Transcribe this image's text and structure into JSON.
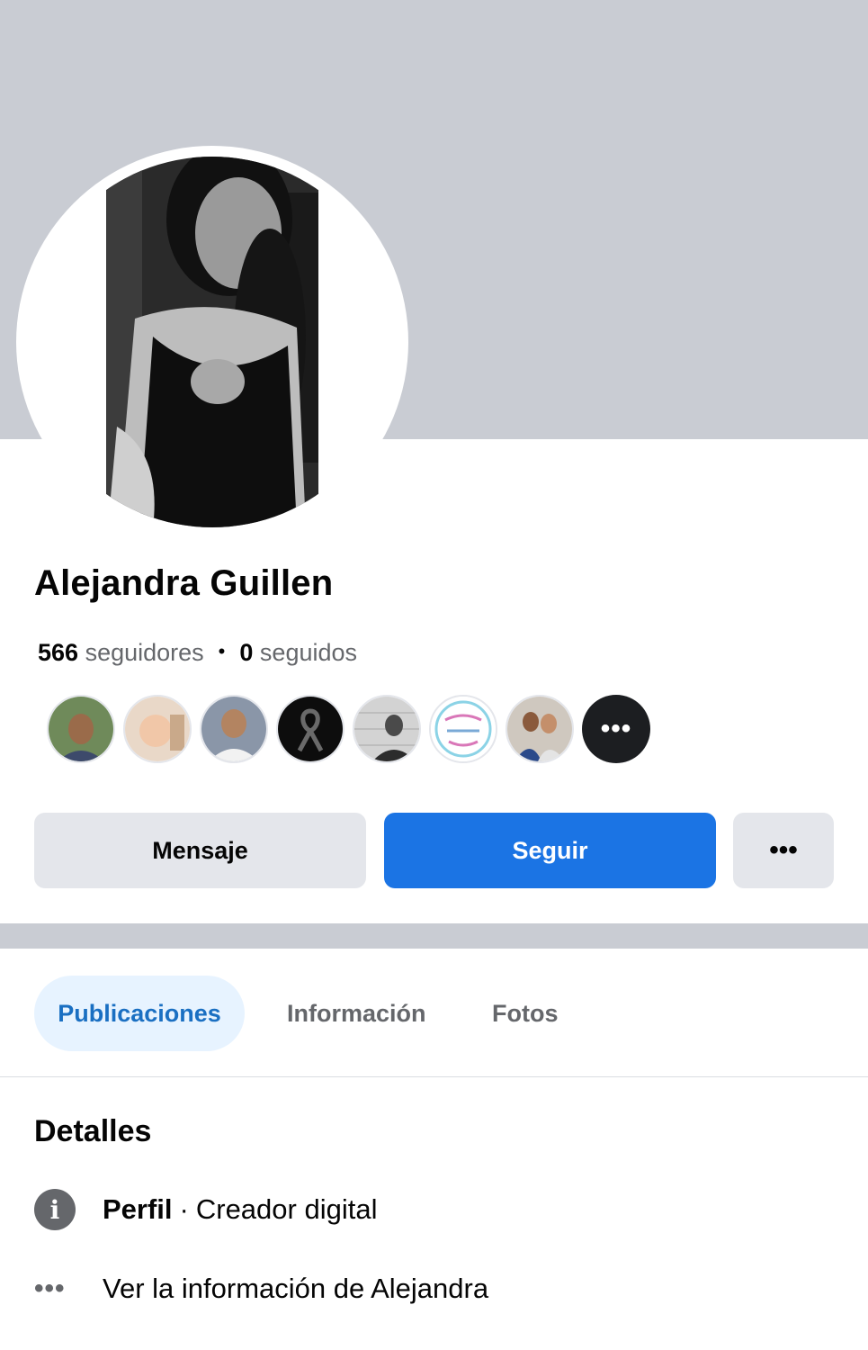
{
  "profile": {
    "name": "Alejandra Guillen",
    "followers_count": "566",
    "followers_label": "seguidores",
    "following_count": "0",
    "following_label": "seguidos",
    "separator": "•"
  },
  "friends": {
    "more_glyph": "•••",
    "avatars": [
      "friend-avatar",
      "friend-avatar",
      "friend-avatar",
      "mourning-ribbon",
      "friend-avatar",
      "page-logo",
      "friend-avatar"
    ]
  },
  "actions": {
    "message_label": "Mensaje",
    "follow_label": "Seguir",
    "more_glyph": "•••"
  },
  "tabs": {
    "posts": "Publicaciones",
    "about": "Información",
    "photos": "Fotos"
  },
  "details": {
    "title": "Detalles",
    "info_icon_glyph": "i",
    "profile_label": "Perfil",
    "profile_separator": "·",
    "profile_type": "Creador digital",
    "see_more_glyph": "•••",
    "see_more_label": "Ver la información de Alejandra"
  },
  "colors": {
    "accent": "#1b74e4",
    "cover": "#c9ccd3",
    "button_gray": "#e4e6eb",
    "active_tab_bg": "#e7f3ff"
  }
}
